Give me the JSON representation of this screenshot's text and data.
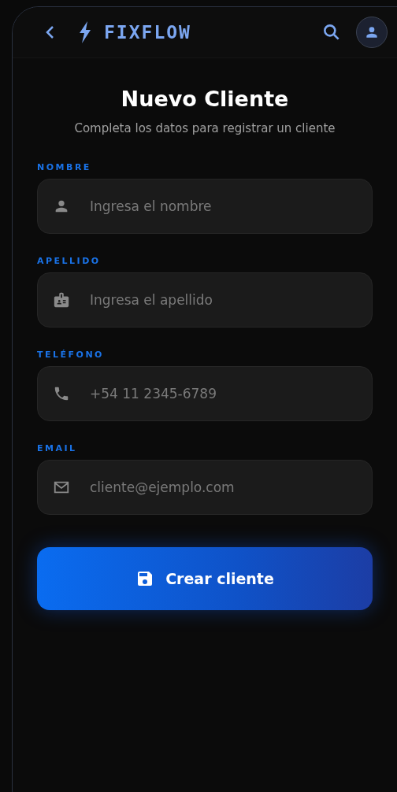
{
  "header": {
    "brand": "FIXFLOW"
  },
  "page": {
    "title": "Nuevo Cliente",
    "subtitle": "Completa los datos para registrar un cliente"
  },
  "fields": [
    {
      "kind": "person",
      "label": "NOMBRE",
      "placeholder": "Ingresa el nombre"
    },
    {
      "kind": "badge",
      "label": "APELLIDO",
      "placeholder": "Ingresa el apellido"
    },
    {
      "kind": "phone",
      "label": "TELÉFONO",
      "placeholder": "+54 11 2345-6789"
    },
    {
      "kind": "email",
      "label": "EMAIL",
      "placeholder": "cliente@ejemplo.com"
    }
  ],
  "submit": {
    "label": "Crear cliente"
  }
}
